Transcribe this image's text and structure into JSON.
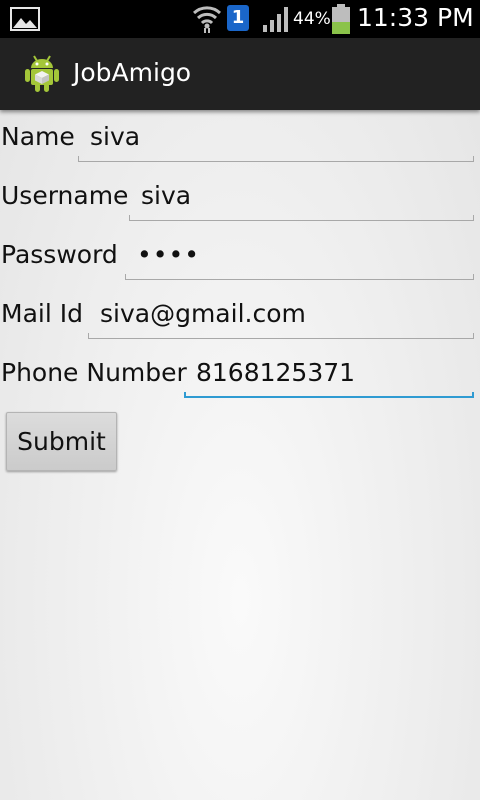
{
  "status_bar": {
    "battery_percent": "44%",
    "sim_badge": "1",
    "time": "11:33 PM",
    "icons": [
      "gallery-icon",
      "wifi-icon",
      "sim-icon",
      "signal-icon",
      "battery-icon"
    ],
    "battery_level": 0.44,
    "battery_color": "#8bc34a"
  },
  "action_bar": {
    "title": "JobAmigo",
    "icon": "android-icon",
    "background": "#222222"
  },
  "form": {
    "name": {
      "label": "Name",
      "value": "siva"
    },
    "username": {
      "label": "Username",
      "value": "siva"
    },
    "password": {
      "label": "Password",
      "value": "••••"
    },
    "mail": {
      "label": "Mail Id",
      "value": "siva@gmail.com"
    },
    "phone": {
      "label": "Phone Number",
      "value": "8168125371"
    },
    "focused_field": "phone",
    "focus_color": "#2f9bd2"
  },
  "submit": {
    "label": "Submit"
  }
}
